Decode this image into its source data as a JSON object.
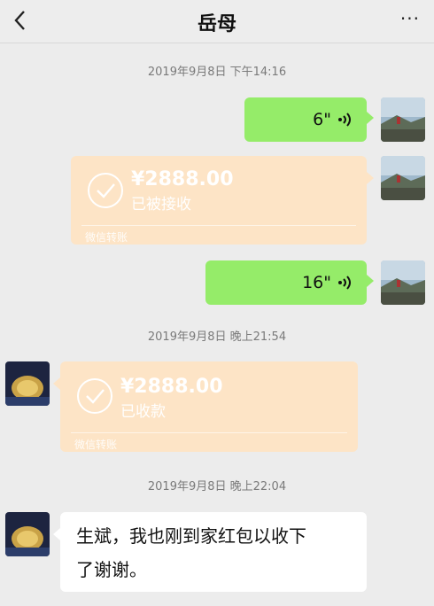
{
  "header": {
    "title": "岳母",
    "back_icon": "chevron-left-icon",
    "more_icon": "more-dots-icon",
    "more_label": "···"
  },
  "timestamps": [
    "2019年9月8日 下午14:16",
    "2019年9月8日 晚上21:54",
    "2019年9月8日 晚上22:04"
  ],
  "messages": {
    "voice1": {
      "duration": "6\"",
      "icon": "voice-wave-icon"
    },
    "transfer1": {
      "amount": "¥2888.00",
      "status": "已被接收",
      "label": "微信转账"
    },
    "voice2": {
      "duration": "16\"",
      "icon": "voice-wave-icon"
    },
    "transfer2": {
      "amount": "¥2888.00",
      "status": "已收款",
      "label": "微信转账"
    },
    "text1": {
      "line1": "生斌，我也刚到家红包以收下",
      "line2": "了谢谢。"
    }
  },
  "colors": {
    "sent_bubble": "#95ec69",
    "transfer_bubble": "#fde4c6",
    "background": "#ececec"
  }
}
